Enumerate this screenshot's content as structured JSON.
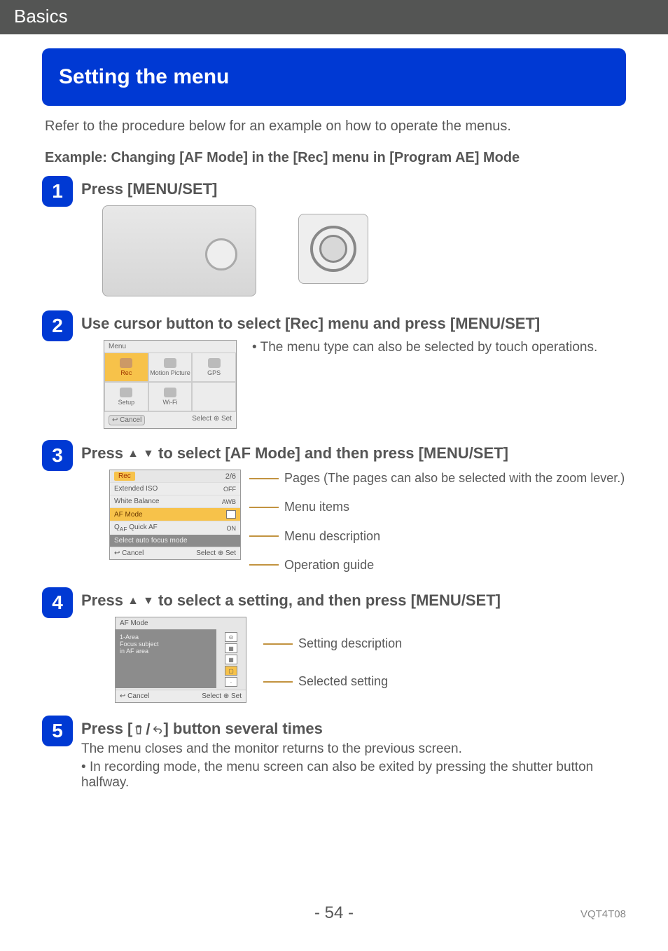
{
  "header": {
    "section": "Basics"
  },
  "title": "Setting the menu",
  "intro": "Refer to the procedure below for an example on how to operate the menus.",
  "example_heading": "Example: Changing [AF Mode] in the [Rec] menu in [Program AE] Mode",
  "steps": {
    "s1": {
      "num": "1",
      "title": "Press [MENU/SET]"
    },
    "s2": {
      "num": "2",
      "title": "Use cursor button to select [Rec] menu and press [MENU/SET]",
      "note": "The menu type can also be selected by touch operations.",
      "screen": {
        "title": "Menu",
        "items": [
          "Rec",
          "Motion Picture",
          "GPS",
          "Setup",
          "Wi-Fi",
          ""
        ],
        "cancel": "Cancel",
        "select": "Select",
        "set": "Set"
      }
    },
    "s3": {
      "num": "3",
      "title_a": "Press ",
      "title_b": " to select [AF Mode] and then press [MENU/SET]",
      "screen": {
        "tab": "Rec",
        "page": "2/6",
        "rows": [
          {
            "label": "Extended ISO",
            "val": "OFF"
          },
          {
            "label": "White Balance",
            "val": "AWB"
          },
          {
            "label": "AF Mode",
            "val": "",
            "sel": true
          },
          {
            "label": "Quick AF",
            "val": "ON"
          }
        ],
        "desc": "Select auto focus mode",
        "cancel": "Cancel",
        "select": "Select",
        "set": "Set"
      },
      "callouts": {
        "pages": "Pages (The pages can also be selected with the zoom lever.)",
        "items": "Menu items",
        "desc": "Menu description",
        "guide": "Operation guide"
      }
    },
    "s4": {
      "num": "4",
      "title_a": "Press ",
      "title_b": " to select a setting, and then press [MENU/SET]",
      "screen": {
        "title": "AF Mode",
        "desc_lines": [
          "1-Area",
          "Focus subject",
          "in AF area"
        ],
        "cancel": "Cancel",
        "select": "Select",
        "set": "Set"
      },
      "callouts": {
        "setting_desc": "Setting description",
        "selected": "Selected setting"
      }
    },
    "s5": {
      "num": "5",
      "title_a": "Press [",
      "title_b": "] button several times",
      "line1": "The menu closes and the monitor returns to the previous screen.",
      "line2": "In recording mode, the menu screen can also be exited by pressing the shutter button halfway."
    }
  },
  "footer": {
    "page": "- 54 -",
    "doc_code": "VQT4T08"
  }
}
